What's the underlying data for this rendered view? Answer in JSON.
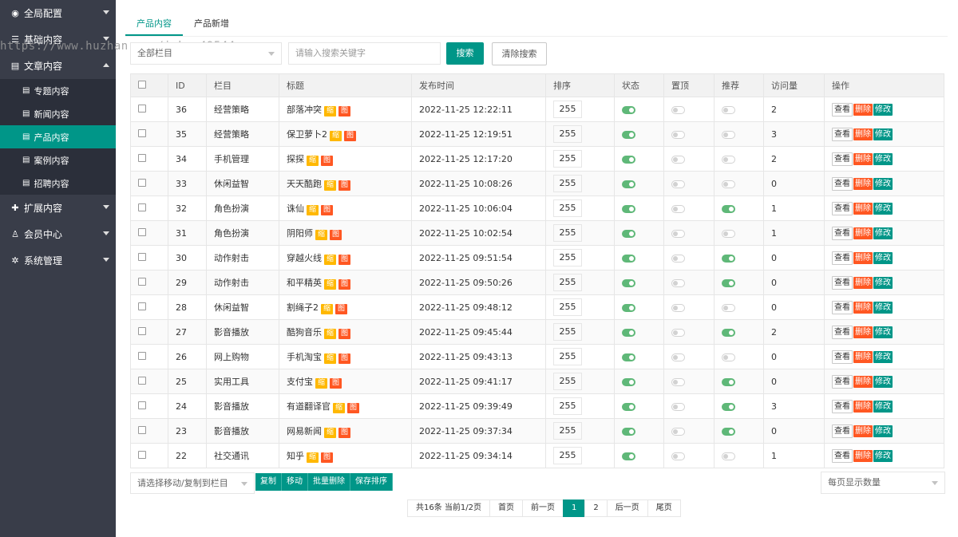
{
  "watermark": "https://www.huzhan.com/ishop49544",
  "sidebar": {
    "groups": [
      {
        "label": "全局配置",
        "icon": "globe-icon",
        "glyph": "◉",
        "expanded": false
      },
      {
        "label": "基础内容",
        "icon": "sliders-icon",
        "glyph": "☰",
        "expanded": false
      },
      {
        "label": "文章内容",
        "icon": "document-icon",
        "glyph": "▤",
        "expanded": true,
        "items": [
          {
            "label": "专题内容",
            "active": false
          },
          {
            "label": "新闻内容",
            "active": false
          },
          {
            "label": "产品内容",
            "active": true
          },
          {
            "label": "案例内容",
            "active": false
          },
          {
            "label": "招聘内容",
            "active": false
          }
        ]
      },
      {
        "label": "扩展内容",
        "icon": "puzzle-icon",
        "glyph": "✚",
        "expanded": false
      },
      {
        "label": "会员中心",
        "icon": "user-icon",
        "glyph": "♙",
        "expanded": false
      },
      {
        "label": "系统管理",
        "icon": "gear-icon",
        "glyph": "✲",
        "expanded": false
      }
    ]
  },
  "tabs": [
    {
      "label": "产品内容",
      "active": true
    },
    {
      "label": "产品新增",
      "active": false
    }
  ],
  "filter": {
    "category_value": "全部栏目",
    "search_placeholder": "请输入搜索关键字",
    "search_label": "搜索",
    "clear_label": "清除搜索"
  },
  "table": {
    "headers": [
      "",
      "ID",
      "栏目",
      "标题",
      "发布时间",
      "排序",
      "状态",
      "置顶",
      "推荐",
      "访问量",
      "操作"
    ],
    "tag_thumb": "缩",
    "tag_pic": "图",
    "op_view": "查看",
    "op_delete": "删除",
    "op_edit": "修改",
    "rows": [
      {
        "id": "36",
        "category": "经营策略",
        "title": "部落冲突",
        "time": "2022-11-25 12:22:11",
        "sort": "255",
        "status": true,
        "top": false,
        "recommend": false,
        "visits": "2"
      },
      {
        "id": "35",
        "category": "经营策略",
        "title": "保卫萝卜2",
        "time": "2022-11-25 12:19:51",
        "sort": "255",
        "status": true,
        "top": false,
        "recommend": false,
        "visits": "3"
      },
      {
        "id": "34",
        "category": "手机管理",
        "title": "探探",
        "time": "2022-11-25 12:17:20",
        "sort": "255",
        "status": true,
        "top": false,
        "recommend": false,
        "visits": "2"
      },
      {
        "id": "33",
        "category": "休闲益智",
        "title": "天天酷跑",
        "time": "2022-11-25 10:08:26",
        "sort": "255",
        "status": true,
        "top": false,
        "recommend": false,
        "visits": "0"
      },
      {
        "id": "32",
        "category": "角色扮演",
        "title": "诛仙",
        "time": "2022-11-25 10:06:04",
        "sort": "255",
        "status": true,
        "top": false,
        "recommend": true,
        "visits": "1"
      },
      {
        "id": "31",
        "category": "角色扮演",
        "title": "阴阳师",
        "time": "2022-11-25 10:02:54",
        "sort": "255",
        "status": true,
        "top": false,
        "recommend": false,
        "visits": "1"
      },
      {
        "id": "30",
        "category": "动作射击",
        "title": "穿越火线",
        "time": "2022-11-25 09:51:54",
        "sort": "255",
        "status": true,
        "top": false,
        "recommend": true,
        "visits": "0"
      },
      {
        "id": "29",
        "category": "动作射击",
        "title": "和平精英",
        "time": "2022-11-25 09:50:26",
        "sort": "255",
        "status": true,
        "top": false,
        "recommend": true,
        "visits": "0"
      },
      {
        "id": "28",
        "category": "休闲益智",
        "title": "割绳子2",
        "time": "2022-11-25 09:48:12",
        "sort": "255",
        "status": true,
        "top": false,
        "recommend": false,
        "visits": "0"
      },
      {
        "id": "27",
        "category": "影音播放",
        "title": "酷狗音乐",
        "time": "2022-11-25 09:45:44",
        "sort": "255",
        "status": true,
        "top": false,
        "recommend": true,
        "visits": "2"
      },
      {
        "id": "26",
        "category": "网上购物",
        "title": "手机淘宝",
        "time": "2022-11-25 09:43:13",
        "sort": "255",
        "status": true,
        "top": false,
        "recommend": false,
        "visits": "0"
      },
      {
        "id": "25",
        "category": "实用工具",
        "title": "支付宝",
        "time": "2022-11-25 09:41:17",
        "sort": "255",
        "status": true,
        "top": false,
        "recommend": true,
        "visits": "0"
      },
      {
        "id": "24",
        "category": "影音播放",
        "title": "有道翻译官",
        "time": "2022-11-25 09:39:49",
        "sort": "255",
        "status": true,
        "top": false,
        "recommend": true,
        "visits": "3"
      },
      {
        "id": "23",
        "category": "影音播放",
        "title": "网易新闻",
        "time": "2022-11-25 09:37:34",
        "sort": "255",
        "status": true,
        "top": false,
        "recommend": true,
        "visits": "0"
      },
      {
        "id": "22",
        "category": "社交通讯",
        "title": "知乎",
        "time": "2022-11-25 09:34:14",
        "sort": "255",
        "status": true,
        "top": false,
        "recommend": false,
        "visits": "1"
      }
    ]
  },
  "bulk": {
    "move_placeholder": "请选择移动/复制到栏目",
    "buttons": [
      "复制",
      "移动",
      "批量删除",
      "保存排序"
    ]
  },
  "per_page_placeholder": "每页显示数量",
  "pagination": {
    "summary": "共16条 当前1/2页",
    "first": "首页",
    "prev": "前一页",
    "pages": [
      "1",
      "2"
    ],
    "current": "1",
    "next": "后一页",
    "last": "尾页"
  },
  "colors": {
    "sidebar_bg": "#393d49",
    "accent": "#009688",
    "danger": "#ff5722",
    "warn": "#ffb800",
    "switch_on": "#5fb878"
  }
}
